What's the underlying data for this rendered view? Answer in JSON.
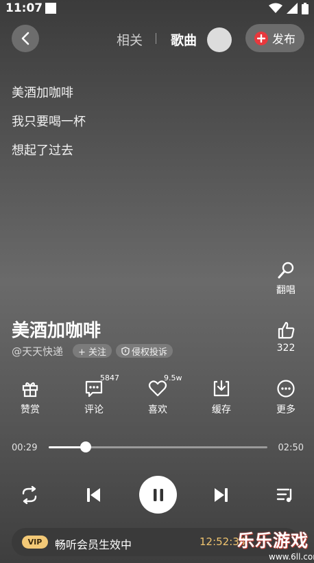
{
  "status_bar": {
    "time": "11:07"
  },
  "header": {
    "tabs": [
      {
        "label": "相关",
        "active": false
      },
      {
        "label": "歌曲",
        "active": true
      }
    ],
    "publish_label": "发布"
  },
  "lyrics": [
    "美酒加咖啡",
    "我只要喝一杯",
    "想起了过去"
  ],
  "side_actions": {
    "cover": {
      "label": "翻唱"
    },
    "like": {
      "count": "322"
    }
  },
  "song": {
    "title": "美酒加咖啡",
    "author": "@天天快递",
    "follow_label": "+ 关注",
    "report_label": "侵权投诉"
  },
  "actions": [
    {
      "label": "赞赏",
      "icon": "gift-icon"
    },
    {
      "label": "评论",
      "icon": "comment-icon",
      "count": "5847"
    },
    {
      "label": "喜欢",
      "icon": "heart-icon",
      "count": "9.5w"
    },
    {
      "label": "缓存",
      "icon": "download-icon"
    },
    {
      "label": "更多",
      "icon": "more-icon"
    }
  ],
  "progress": {
    "current": "00:29",
    "total": "02:50",
    "fraction": 0.17
  },
  "controls": {
    "icons": [
      "repeat-icon",
      "previous-icon",
      "pause-icon",
      "next-icon",
      "playlist-icon"
    ]
  },
  "vip": {
    "badge": "VIP",
    "text": "畅听会员生效中",
    "timer": "12:52:34"
  },
  "watermark": {
    "text": "乐乐游戏",
    "url": "www.6ll.com"
  },
  "colors": {
    "accent_red": "#e8383d",
    "vip_gold": "#f3c977"
  }
}
